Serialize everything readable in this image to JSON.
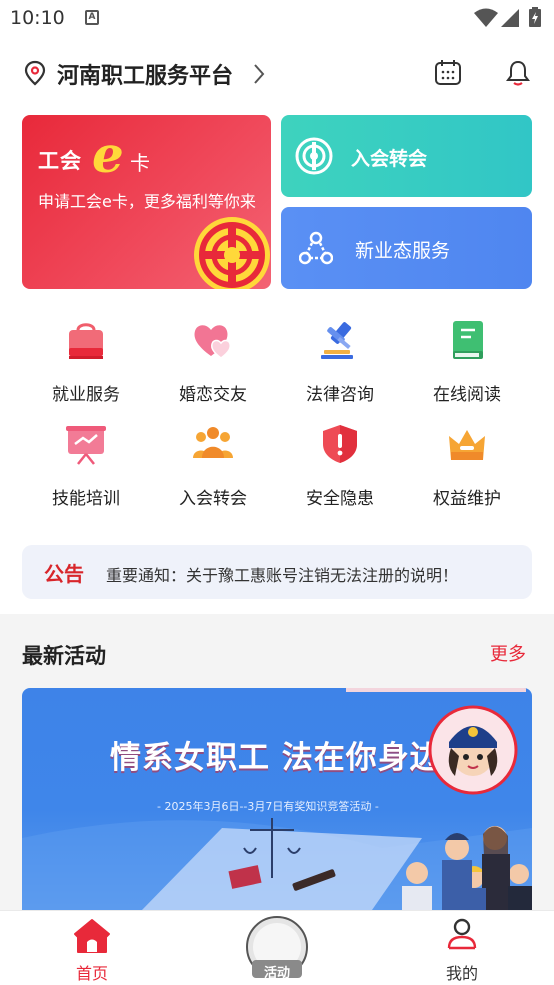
{
  "status_bar": {
    "time": "10:10",
    "notification_letter": "A"
  },
  "header": {
    "title": "河南职工服务平台"
  },
  "cards": {
    "union_card": {
      "prefix": "工会",
      "e": "e",
      "suffix": "卡",
      "description": "申请工会e卡，更多福利等你来"
    },
    "join": {
      "label": "入会转会"
    },
    "new_business": {
      "label": "新业态服务"
    }
  },
  "services": [
    {
      "label": "就业服务",
      "icon": "shopping-bag-icon"
    },
    {
      "label": "婚恋交友",
      "icon": "hearts-icon"
    },
    {
      "label": "法律咨询",
      "icon": "gavel-icon"
    },
    {
      "label": "在线阅读",
      "icon": "book-icon"
    },
    {
      "label": "技能培训",
      "icon": "presentation-board-icon"
    },
    {
      "label": "入会转会",
      "icon": "people-group-icon"
    },
    {
      "label": "安全隐患",
      "icon": "shield-alert-icon"
    },
    {
      "label": "权益维护",
      "icon": "crown-icon"
    }
  ],
  "notice": {
    "tag": "公告",
    "text": "重要通知：关于豫工惠账号注销无法注册的说明！"
  },
  "latest": {
    "title": "最新活动",
    "more": "更多",
    "banner": {
      "title": "情系女职工 法在你身边",
      "subtitle": "- 2025年3月6日--3月7日有奖知识竞答活动 -"
    }
  },
  "tabbar": {
    "home": "首页",
    "activity": "活动",
    "mine": "我的"
  },
  "colors": {
    "brand_red": "#e8293a",
    "teal": "#3ed3be",
    "blue": "#5a90f4"
  }
}
